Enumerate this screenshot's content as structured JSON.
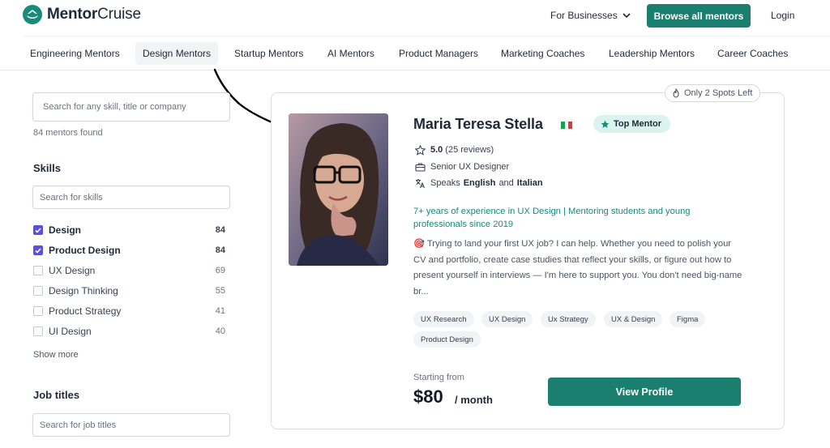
{
  "header": {
    "logo_bold": "Mentor",
    "logo_light": "Cruise",
    "for_businesses": "For Businesses",
    "browse_button": "Browse all mentors",
    "login": "Login"
  },
  "categories": [
    "Engineering Mentors",
    "Design Mentors",
    "Startup Mentors",
    "AI Mentors",
    "Product Managers",
    "Marketing Coaches",
    "Leadership Mentors",
    "Career Coaches"
  ],
  "active_category": "Design Mentors",
  "sidebar": {
    "search_placeholder": "Search for any skill, title or company",
    "mentor_count": "84 mentors found",
    "skills_heading": "Skills",
    "skills_search_placeholder": "Search for skills",
    "skills": [
      {
        "label": "Design",
        "count": "84",
        "checked": true
      },
      {
        "label": "Product Design",
        "count": "84",
        "checked": true
      },
      {
        "label": "UX Design",
        "count": "69",
        "checked": false
      },
      {
        "label": "Design Thinking",
        "count": "55",
        "checked": false
      },
      {
        "label": "Product Strategy",
        "count": "41",
        "checked": false
      },
      {
        "label": "UI Design",
        "count": "40",
        "checked": false
      }
    ],
    "show_more": "Show more",
    "job_titles_heading": "Job titles",
    "job_titles_placeholder": "Search for job titles"
  },
  "mentor_card": {
    "spots_badge": "Only 2 Spots Left",
    "name": "Maria Teresa Stella",
    "badge": "Top Mentor",
    "rating": "5.0",
    "reviews": "(25 reviews)",
    "title": "Senior UX Designer",
    "speaks_prefix": "Speaks",
    "language_1": "English",
    "speaks_and": "and",
    "language_2": "Italian",
    "headline": "7+ years of experience in UX Design | Mentoring students and young professionals since 2019",
    "bio": "🎯 Trying to land your first UX job? I can help. Whether you need to polish your CV and portfolio, create case studies that reflect your skills, or figure out how to present yourself in interviews — I'm here to support you. You don't need big-name br...",
    "tags": [
      "UX Research",
      "UX Design",
      "Ux Strategy",
      "UX & Design",
      "Figma",
      "Product Design"
    ],
    "starting_from": "Starting from",
    "price": "$80",
    "per": "/ month",
    "view_button": "View Profile"
  },
  "colors": {
    "brand": "#1a7f6e",
    "checkbox": "#5b4fe0",
    "headline": "#1a8a7a",
    "badge_bg": "#daf3ee"
  }
}
